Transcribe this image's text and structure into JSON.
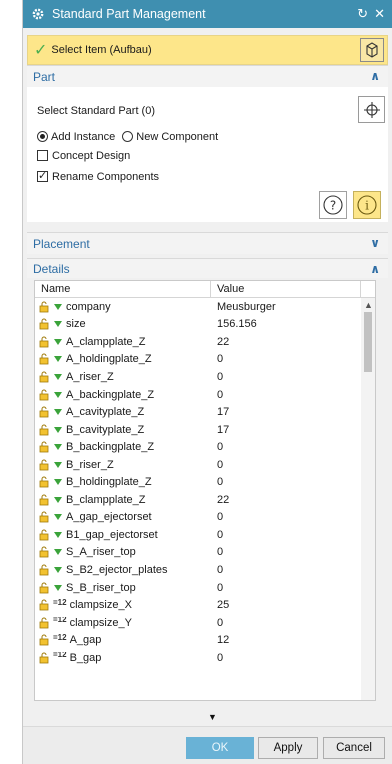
{
  "window": {
    "title": "Standard Part Management",
    "controls": [
      "↻",
      "✕"
    ]
  },
  "select_item": {
    "label": "Select Item (Aufbau)"
  },
  "part": {
    "title": "Part",
    "select_label": "Select Standard Part (0)",
    "radio_add": "Add Instance",
    "radio_new": "New Component",
    "concept_design": "Concept Design",
    "rename_components": "Rename Components"
  },
  "placement": {
    "title": "Placement"
  },
  "details": {
    "title": "Details",
    "col_name": "Name",
    "col_value": "Value",
    "rows": [
      {
        "name": "company",
        "value": "Meusburger",
        "kind": "tri"
      },
      {
        "name": "size",
        "value": "156.156",
        "kind": "tri"
      },
      {
        "name": "A_clampplate_Z",
        "value": "22",
        "kind": "tri"
      },
      {
        "name": "A_holdingplate_Z",
        "value": "0",
        "kind": "tri"
      },
      {
        "name": "A_riser_Z",
        "value": "0",
        "kind": "tri"
      },
      {
        "name": "A_backingplate_Z",
        "value": "0",
        "kind": "tri"
      },
      {
        "name": "A_cavityplate_Z",
        "value": "17",
        "kind": "tri"
      },
      {
        "name": "B_cavityplate_Z",
        "value": "17",
        "kind": "tri"
      },
      {
        "name": "B_backingplate_Z",
        "value": "0",
        "kind": "tri"
      },
      {
        "name": "B_riser_Z",
        "value": "0",
        "kind": "tri"
      },
      {
        "name": "B_holdingplate_Z",
        "value": "0",
        "kind": "tri"
      },
      {
        "name": "B_clampplate_Z",
        "value": "22",
        "kind": "tri"
      },
      {
        "name": "A_gap_ejectorset",
        "value": "0",
        "kind": "tri"
      },
      {
        "name": "B1_gap_ejectorset",
        "value": "0",
        "kind": "tri"
      },
      {
        "name": "S_A_riser_top",
        "value": "0",
        "kind": "tri"
      },
      {
        "name": "S_B2_ejector_plates",
        "value": "0",
        "kind": "tri"
      },
      {
        "name": "S_B_riser_top",
        "value": "0",
        "kind": "tri"
      },
      {
        "name": "clampsize_X",
        "value": "25",
        "kind": "expr"
      },
      {
        "name": "clampsize_Y",
        "value": "0",
        "kind": "expr"
      },
      {
        "name": "A_gap",
        "value": "12",
        "kind": "expr"
      },
      {
        "name": "B_gap",
        "value": "0",
        "kind": "expr"
      }
    ]
  },
  "buttons": {
    "ok": "OK",
    "apply": "Apply",
    "cancel": "Cancel"
  },
  "colors": {
    "titlebar": "#3f8fb0",
    "highlight": "#fde68a",
    "section_text": "#2e6da4",
    "ok_button": "#69b2d6",
    "check": "#4caf50"
  }
}
